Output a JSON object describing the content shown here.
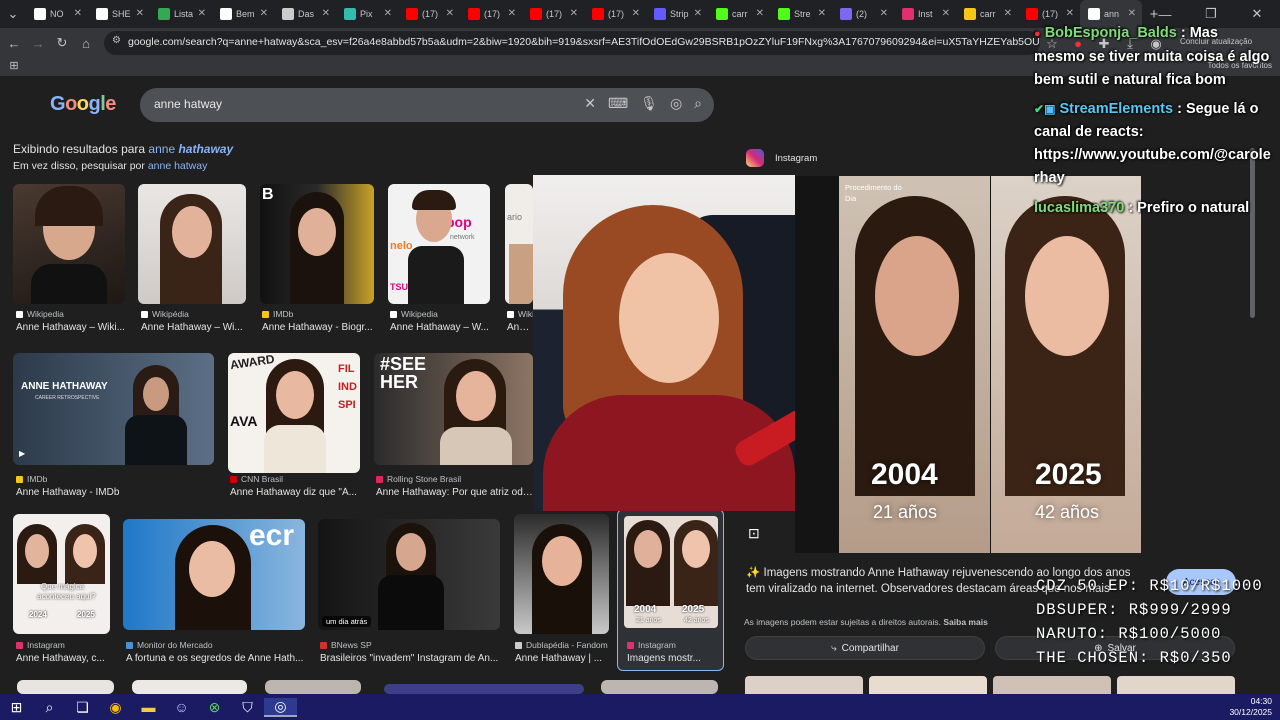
{
  "tabs": [
    {
      "title": "NO",
      "color": "#ffffff"
    },
    {
      "title": "SHE",
      "color": "#ffffff"
    },
    {
      "title": "Lista",
      "color": "#34a853"
    },
    {
      "title": "Bem",
      "color": "#ffffff"
    },
    {
      "title": "Das",
      "color": "#cccccc"
    },
    {
      "title": "Pix",
      "color": "#32bcad"
    },
    {
      "title": "(17)",
      "color": "#ff0000"
    },
    {
      "title": "(17)",
      "color": "#ff0000"
    },
    {
      "title": "(17)",
      "color": "#ff0000"
    },
    {
      "title": "(17)",
      "color": "#ff0000"
    },
    {
      "title": "Strip",
      "color": "#635bff"
    },
    {
      "title": "carr",
      "color": "#53fc18"
    },
    {
      "title": "Stre",
      "color": "#53fc18"
    },
    {
      "title": "(2)",
      "color": "#7b68ee"
    },
    {
      "title": "Inst",
      "color": "#e1306c"
    },
    {
      "title": "carr",
      "color": "#f5c518"
    },
    {
      "title": "(17)",
      "color": "#ff0000"
    },
    {
      "title": "ann",
      "color": "#ffffff"
    }
  ],
  "toolbar": {
    "url": "google.com/search?q=anne+hatway&sca_esv=f26a4e8abbd57b5a&udm=2&biw=1920&bih=919&sxsrf=AE3TifOdOEdGw29BSRB1pOzZYluF19FNxg%3A1767079609294&ei=uX5TaYHZEYab5OUPx5K3yQk&oq=ann&gs_..."
  },
  "search": {
    "logo": "Google",
    "query": "anne hatway"
  },
  "results_note": {
    "showing_prefix": "Exibindo resultados para ",
    "showing_plain": "anne ",
    "showing_bold": "hathaway",
    "instead_prefix": "Em vez disso, pesquisar por ",
    "instead_link": "anne hatway"
  },
  "images": [
    {
      "source": "Wikipedia",
      "caption": "Anne Hathaway – Wiki...",
      "src_color": "#ffffff"
    },
    {
      "source": "Wikipédia",
      "caption": "Anne Hathaway – Wi...",
      "src_color": "#ffffff"
    },
    {
      "source": "IMDb",
      "caption": "Anne Hathaway - Biogr...",
      "src_color": "#f5c518"
    },
    {
      "source": "Wikipedia",
      "caption": "Anne Hathaway – W...",
      "src_color": "#ffffff"
    },
    {
      "source": "Wiki",
      "caption": "Anne H",
      "src_color": "#ffffff"
    },
    {
      "source": "IMDb",
      "caption": "Anne Hathaway - IMDb",
      "src_color": "#f5c518"
    },
    {
      "source": "CNN Brasil",
      "caption": "Anne Hathaway diz que \"Á...",
      "src_color": "#cc0000"
    },
    {
      "source": "Rolling Stone Brasil",
      "caption": "Anne Hathaway: Por que atriz odeia",
      "src_color": "#e0245e"
    },
    {
      "source": "Instagram",
      "caption": "Anne Hathaway, c...",
      "src_color": "#e1306c"
    },
    {
      "source": "Monitor do Mercado",
      "caption": "A fortuna e os segredos de Anne Hath...",
      "src_color": "#4a90d9"
    },
    {
      "source": "BNews SP",
      "caption": "Brasileiros \"invadem\" Instagram de An...",
      "src_color": "#d93025"
    },
    {
      "source": "Dublapédia - Fandom",
      "caption": "Anne Hathaway | ...",
      "src_color": "#cccccc"
    },
    {
      "source": "Instagram",
      "caption": "Imagens mostr...",
      "src_color": "#e1306c"
    }
  ],
  "thumb_text": {
    "poster_title": "ANNE HATHAWAY",
    "poster_sub": "CAREER RETROSPECTIVE",
    "ago": "um dia atrás",
    "q1": "Que mágica",
    "q2": "aconteceu aqui?",
    "y1": "2024",
    "y2": "2025",
    "small_y1": "2004",
    "small_y2": "2025",
    "small_a1": "21 anos",
    "small_a2": "42 anos",
    "see_her": "#SEE HER",
    "awards": "AWARD",
    "ava": "AVA",
    "fil": "FIL",
    "ind": "IND",
    "spi": "SPI",
    "niche": "ecr",
    "pop": "pop",
    "nelo": "nelo",
    "tsuge": "TSUGE",
    "network": "network",
    "ario": "ario"
  },
  "panel": {
    "source": "Instagram",
    "badge": "Procedimento do Dia",
    "year_left": "2004",
    "age_left": "21 años",
    "year_right": "2025",
    "age_right": "42 años",
    "description": "Imagens mostrando Anne Hathaway rejuvenescendo ao longo dos anos tem viralizado na internet. Observadores destacam áreas que não foram alteradas.",
    "desc_line1": "Imagens mostrando Anne Hathaway rejuvenescendo ao longo dos anos",
    "desc_line2": "tem viralizado na internet. Observadores destacam áreas que nos mais",
    "access": "Acessar",
    "disclaimer": "As imagens podem estar sujeitas a direitos autorais.",
    "learn_more": "Saiba mais",
    "share": "Compartilhar",
    "save": "Salvar"
  },
  "update_label": "Concluir atualização",
  "bookmarks_right": "Todos os favoritos",
  "chat": [
    {
      "user": "BobEsponja_Balds",
      "lines": [
        ": Mas",
        "mesmo se tiver muita coisa é algo",
        "bem sutil e natural fica bom"
      ]
    },
    {
      "user": "StreamElements",
      "lines": [
        ": Segue lá o",
        "canal de reacts:",
        "https://www.youtube.com/@carole",
        "rhay"
      ]
    },
    {
      "user": "lucaslima370",
      "lines": [
        ": Prefiro o natural"
      ]
    }
  ],
  "prices": [
    "CDZ 50 EP: R$10/R$1000",
    "DBSUPER: R$999/2999",
    "NARUTO: R$100/5000",
    "THE CHOSEN: R$0/350"
  ],
  "clock": {
    "time": "04:30",
    "date": "30/12/2025"
  }
}
